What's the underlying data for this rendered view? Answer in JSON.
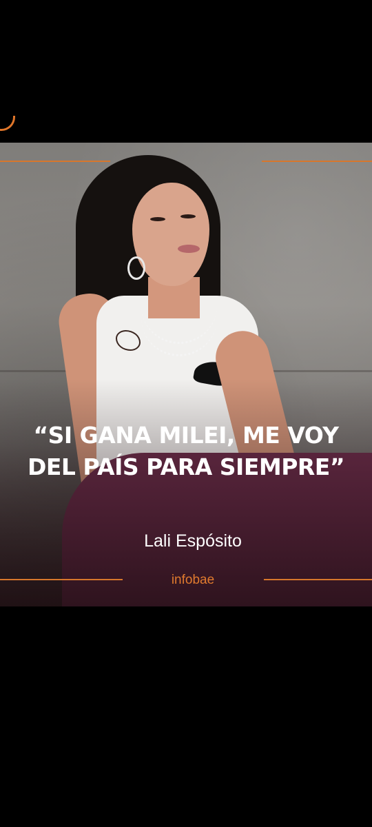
{
  "post": {
    "quote": "“SI GANA MILEI, ME VOY DEL PAÍS PARA SIEMPRE”",
    "author": "Lali Espósito",
    "source": "infobae"
  },
  "colors": {
    "accent": "#d8772c",
    "source_text": "#e07a2e",
    "background": "#000000",
    "quote_text": "#ffffff"
  },
  "icons": {
    "corner": "orange-logo-fragment-icon"
  }
}
